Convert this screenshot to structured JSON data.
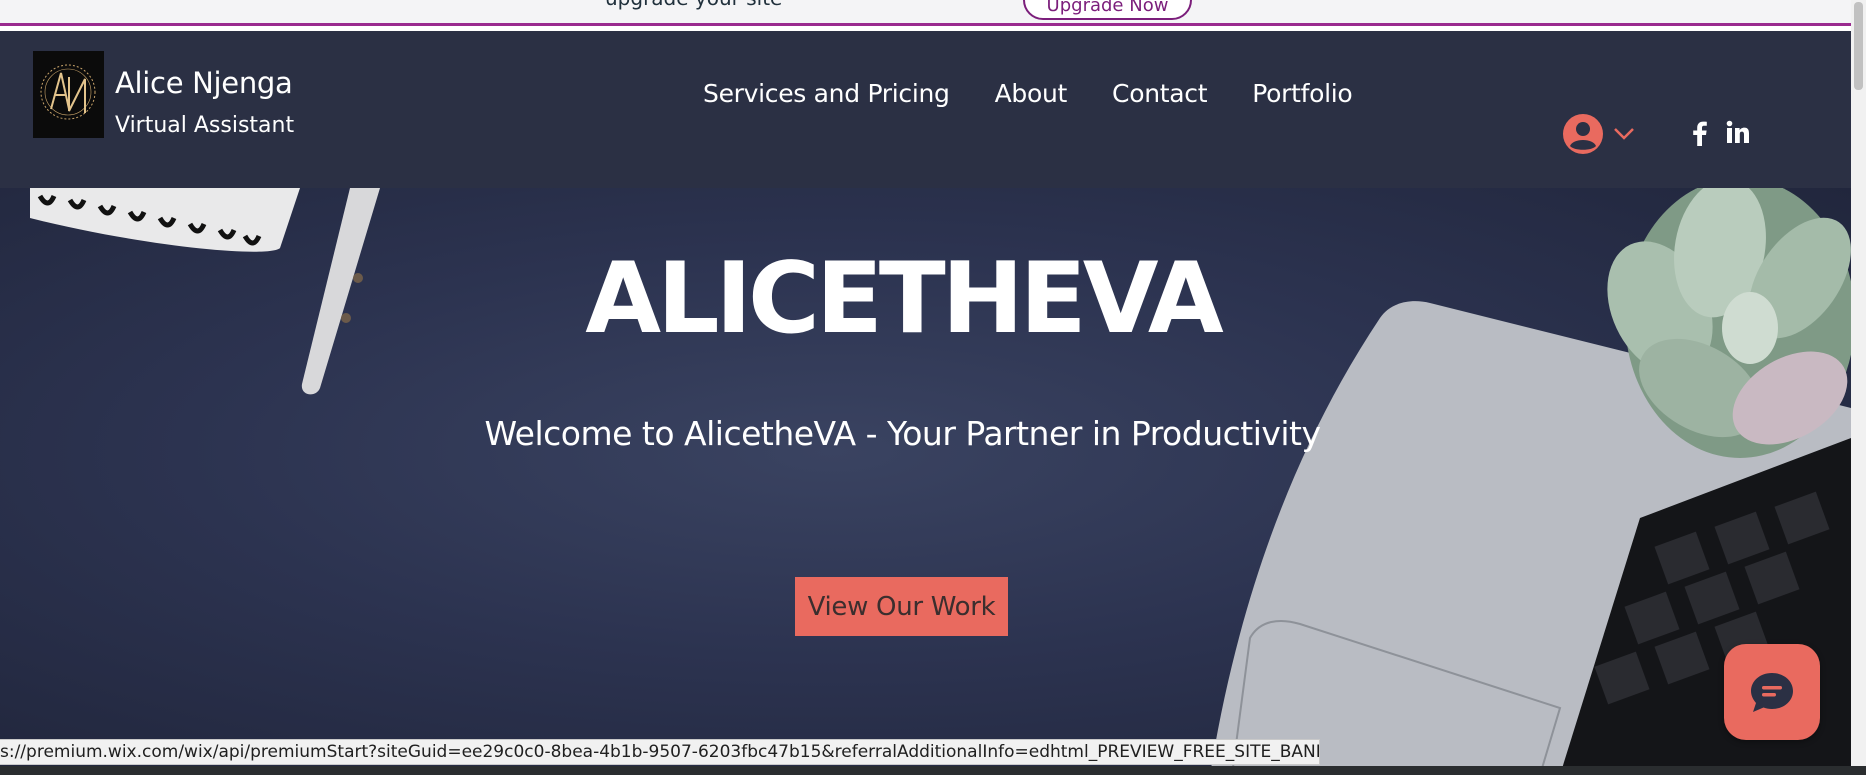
{
  "banner": {
    "text": "upgrade your site",
    "button_label": "Upgrade Now"
  },
  "header": {
    "brand_name": "Alice Njenga",
    "brand_tagline": "Virtual Assistant",
    "logo_text": "AN",
    "nav": [
      {
        "label": "Services and Pricing"
      },
      {
        "label": "About"
      },
      {
        "label": "Contact"
      },
      {
        "label": "Portfolio"
      }
    ],
    "user_menu_icon": "account-circle-icon",
    "social": [
      {
        "icon": "facebook-icon"
      },
      {
        "icon": "linkedin-icon"
      }
    ]
  },
  "hero": {
    "title": "ALICETHEVA",
    "subtitle": "Welcome to AlicetheVA - Your Partner in Productivity",
    "cta_label": "View Our Work"
  },
  "chat": {
    "icon": "chat-bubble-icon"
  },
  "status_bar": {
    "url": "s://premium.wix.com/wix/api/premiumStart?siteGuid=ee29c0c0-8bea-4b1b-9507-6203fbc47b15&referralAdditionalInfo=edhtml_PREVIEW_FREE_SITE_BANNER_CLICK"
  },
  "colors": {
    "header_bg": "#2b3044",
    "accent": "#e96a5f",
    "banner_accent": "#9a2a8f",
    "hero_bg": "#2c3350"
  }
}
